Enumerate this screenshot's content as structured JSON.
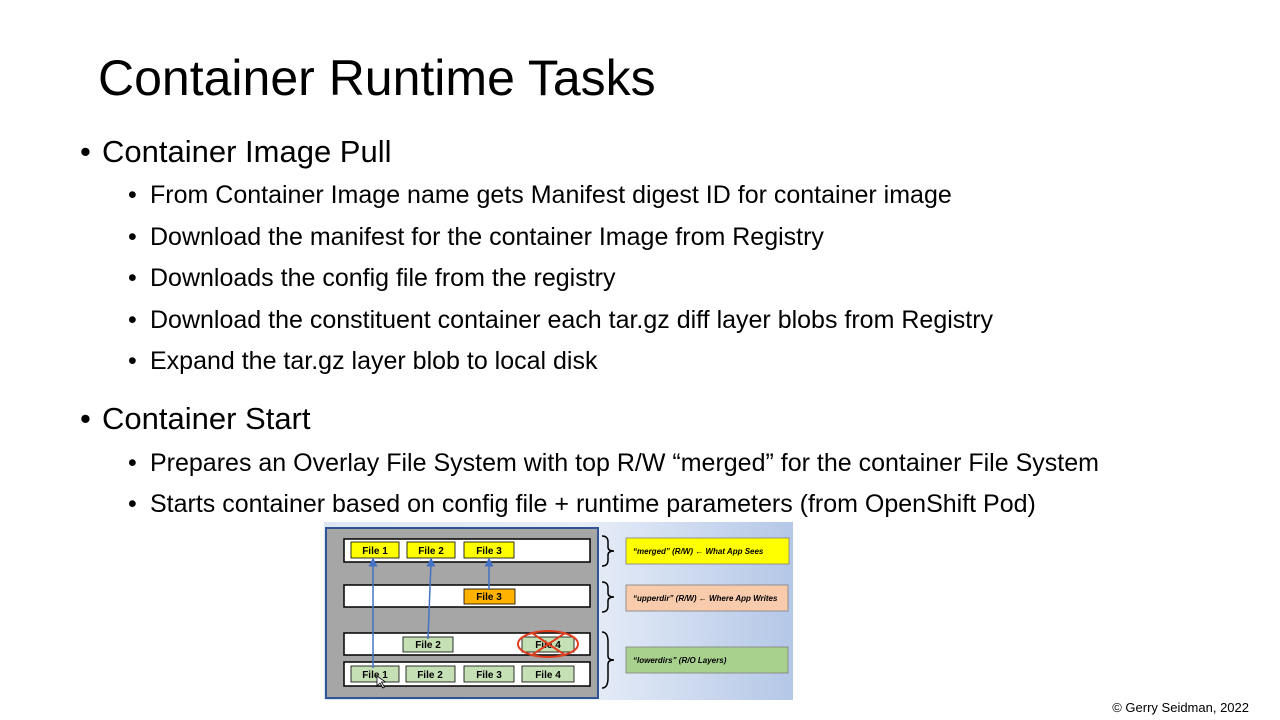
{
  "slide": {
    "title": "Container Runtime Tasks",
    "sections": [
      {
        "heading": "Container Image Pull",
        "items": [
          "From Container Image name gets Manifest digest ID for container image",
          "Download the manifest for the container Image from Registry",
          "Downloads the config file from the registry",
          "Download the constituent container each tar.gz diff layer blobs from Registry",
          "Expand the tar.gz layer blob to local disk"
        ]
      },
      {
        "heading": "Container Start",
        "items": [
          "Prepares an Overlay File System with top R/W “merged” for the container File System",
          "Starts container based on config file + runtime parameters (from OpenShift Pod)"
        ]
      }
    ],
    "copyright": "© Gerry Seidman, 2022"
  },
  "diagram": {
    "merged_files": [
      "File 1",
      "File 2",
      "File 3"
    ],
    "upper_files": [
      "File 3"
    ],
    "lower_top_files": [
      "File 2",
      "File 4"
    ],
    "lower_bottom_files": [
      "File 1",
      "File 2",
      "File 3",
      "File 4"
    ],
    "labels": {
      "merged": "“merged” (R/W) ← What App Sees",
      "upperdir": "“upperdir” (R/W) ← Where App Writes",
      "lowerdirs": "“lowerdirs” (R/O Layers)"
    },
    "colors": {
      "merged": "#ffff00",
      "upper": "#ffb300",
      "lower": "#c5e0b4",
      "label_merged": "#ffff00",
      "label_upper": "#f8cbad",
      "label_lower": "#a9d18e",
      "panel": "#a6a6a6",
      "deleted_mark": "#e03c1e",
      "arrow": "#4472c4"
    }
  }
}
